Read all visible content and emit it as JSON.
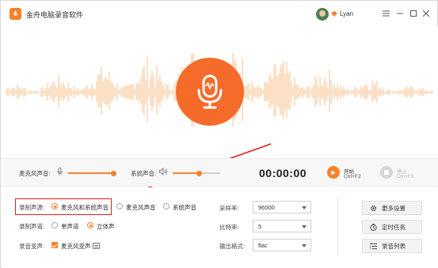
{
  "app": {
    "title": "金舟电脑录音软件",
    "user": "Lyan",
    "accent": "#f5822a",
    "icons": [
      "app-logo-icon",
      "avatar",
      "vip-icon",
      "menu-icon",
      "minimize-icon",
      "restore-icon",
      "close-icon"
    ]
  },
  "controls": {
    "mic_volume_label": "麦克风声音:",
    "mic_volume_level": 0.95,
    "system_volume_label": "系统声音:",
    "system_volume_level": 0.55,
    "timer": "00:00:00",
    "start_label": "开始",
    "start_shortcut": "Ctrl+F2",
    "stop_label": "停止",
    "stop_shortcut": "Ctrl+F3"
  },
  "settings": {
    "source": {
      "label": "录制声源:",
      "options": [
        "麦克风和系统声音",
        "麦克风声音",
        "系统声音"
      ],
      "selected": "麦克风和系统声音"
    },
    "channel": {
      "label": "录制声道:",
      "options": [
        "单声道",
        "立体声"
      ],
      "selected": "立体声"
    },
    "voice_change": {
      "label": "录音变声:",
      "checkbox_label": "麦克风变声",
      "checked": true
    },
    "sample_rate": {
      "label": "采样率:",
      "value": "96000"
    },
    "bit_rate": {
      "label": "比特率:",
      "value": "5"
    },
    "output_format": {
      "label": "输出格式:",
      "value": "flac"
    }
  },
  "side_buttons": {
    "more_settings": "更多设置",
    "scheduled_task": "定时任务",
    "record_list": "录音列表"
  }
}
